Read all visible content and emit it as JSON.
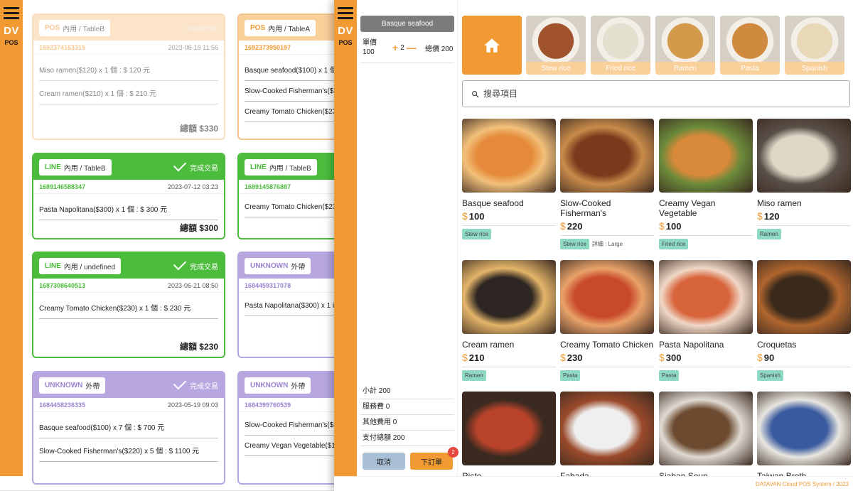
{
  "app": {
    "brand": "DV",
    "brand_sub": "POS"
  },
  "orders": [
    {
      "id": "o1",
      "theme": "pos",
      "source": "POS",
      "table": "內用 / TableB",
      "status": "已完成交易",
      "order_no": "1692374163315",
      "time": "2023-08-18 11:56",
      "items": [
        "Miso ramen($120) x 1 個 : $ 120 元",
        "Cream ramen($210) x 1 個 : $ 210 元"
      ],
      "total": "總額 $330"
    },
    {
      "id": "o2",
      "theme": "pos",
      "source": "POS",
      "table": "內用 / TableA",
      "status": "",
      "order_no": "1692373950197",
      "time": "",
      "items": [
        "Basque seafood($100) x 1 個",
        "Slow-Cooked Fisherman's($2",
        "Creamy Tomato Chicken($23"
      ],
      "total": ""
    },
    {
      "id": "o3",
      "theme": "line",
      "source": "LINE",
      "table": "內用 / TableB",
      "status": "完成交易",
      "order_no": "1689146588347",
      "time": "2023-07-12 03:23",
      "items": [
        "Pasta Napolitana($300) x 1 個 : $ 300 元"
      ],
      "total": "總額 $300"
    },
    {
      "id": "o4",
      "theme": "line",
      "source": "LINE",
      "table": "內用 / TableB",
      "status": "",
      "order_no": "1689145876887",
      "time": "",
      "items": [
        "Creamy Tomato Chicken($23"
      ],
      "total": ""
    },
    {
      "id": "o5",
      "theme": "line",
      "source": "LINE",
      "table": "內用 / undefined",
      "status": "完成交易",
      "order_no": "1687308640513",
      "time": "2023-06-21 08:50",
      "items": [
        "Creamy Tomato Chicken($230) x 1 個 : $ 230 元"
      ],
      "total": "總額 $230"
    },
    {
      "id": "o6",
      "theme": "unknown",
      "source": "UNKNOWN",
      "table": "外帶",
      "status": "",
      "order_no": "1684459317078",
      "time": "",
      "items": [
        "Pasta Napolitana($300) x 1 i"
      ],
      "total": ""
    },
    {
      "id": "o7",
      "theme": "unknown",
      "source": "UNKNOWN",
      "table": "外帶",
      "status": "完成交易",
      "order_no": "1684458236335",
      "time": "2023-05-19 09:03",
      "items": [
        "Basque seafood($100) x 7 個 : $ 700 元",
        "Slow-Cooked Fisherman's($220) x 5 個 : $ 1100 元"
      ],
      "total": ""
    },
    {
      "id": "o8",
      "theme": "unknown",
      "source": "UNKNOWN",
      "table": "外帶",
      "status": "",
      "order_no": "1684399760539",
      "time": "",
      "items": [
        "Slow-Cooked Fisherman's($2",
        "Creamy Vegan Vegetable($1"
      ],
      "total": ""
    }
  ],
  "cart": {
    "title": "Basque seafood",
    "unit_label": "單價",
    "unit_price": "100",
    "qty": "2",
    "plus": "+",
    "minus": "—",
    "total_text": "總價 200",
    "subtotal": "小計 200",
    "service": "服務費 0",
    "other": "其他費用 0",
    "pay_total": "支付總額 200",
    "cancel": "取消",
    "order": "下訂單",
    "order_badge": "2"
  },
  "categories": [
    {
      "label": "Stew rice",
      "color": "#a0522d"
    },
    {
      "label": "Fried rice",
      "color": "#e4e0cf"
    },
    {
      "label": "Ramen",
      "color": "#d49a4c"
    },
    {
      "label": "Pasta",
      "color": "#cf8a3f"
    },
    {
      "label": "Spanish",
      "color": "#e8d8b8"
    }
  ],
  "search": {
    "placeholder": "搜尋項目"
  },
  "products": [
    {
      "name": "Basque seafood",
      "price": "100",
      "tags": [
        "Stew rice"
      ],
      "detail": "",
      "color1": "#e58a3a",
      "color2": "#f2c07a"
    },
    {
      "name": "Slow-Cooked Fisherman's",
      "price": "220",
      "tags": [
        "Stew rice"
      ],
      "detail": "詳細 : Large",
      "color1": "#7a3b1d",
      "color2": "#c98b4a"
    },
    {
      "name": "Creamy Vegan Vegetable",
      "price": "100",
      "tags": [
        "Fried rice"
      ],
      "detail": "",
      "color1": "#d9893a",
      "color2": "#6a8a3a"
    },
    {
      "name": "Miso ramen",
      "price": "120",
      "tags": [
        "Ramen"
      ],
      "detail": "",
      "color1": "#e0d6c6",
      "color2": "#5a5048"
    },
    {
      "name": "Cream ramen",
      "price": "210",
      "tags": [
        "Ramen"
      ],
      "detail": "",
      "color1": "#2e2622",
      "color2": "#e4b56a"
    },
    {
      "name": "Creamy Tomato Chicken",
      "price": "230",
      "tags": [
        "Pasta"
      ],
      "detail": "",
      "color1": "#c84a2a",
      "color2": "#e9a26a"
    },
    {
      "name": "Pasta Napolitana",
      "price": "300",
      "tags": [
        "Pasta"
      ],
      "detail": "",
      "color1": "#d8643c",
      "color2": "#f0d8c6"
    },
    {
      "name": "Croquetas",
      "price": "90",
      "tags": [
        "Spanish"
      ],
      "detail": "",
      "color1": "#3a2a1c",
      "color2": "#b0662e"
    },
    {
      "name": "Risto",
      "price": "",
      "tags": [],
      "detail": "",
      "color1": "#b8432a",
      "color2": "#3a2a20"
    },
    {
      "name": "Fabada",
      "price": "",
      "tags": [],
      "detail": "",
      "color1": "#efefef",
      "color2": "#9a4a2a"
    },
    {
      "name": "Siaban Soup",
      "price": "",
      "tags": [],
      "detail": "",
      "color1": "#6b4a30",
      "color2": "#e0dad2"
    },
    {
      "name": "Taiwan Broth",
      "price": "",
      "tags": [],
      "detail": "",
      "color1": "#3a5aa0",
      "color2": "#e8e6e0"
    }
  ],
  "footer": "DATAVAN Cloud POS System / 2023",
  "colors": {
    "accent": "#f19a33",
    "line": "#4cbc3c",
    "unknown": "#b7a6e0",
    "pos_light": "#f9cf9a",
    "tag": "#8ed9c3"
  }
}
